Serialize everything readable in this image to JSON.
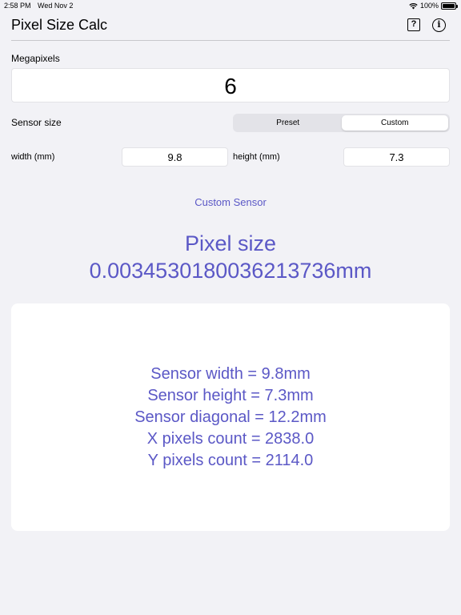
{
  "status_bar": {
    "time": "2:58 PM",
    "date": "Wed Nov 2",
    "battery": "100%"
  },
  "nav": {
    "title": "Pixel Size Calc",
    "help_icon_glyph": "?",
    "info_icon_glyph": "i"
  },
  "megapixels": {
    "label": "Megapixels",
    "value": "6"
  },
  "sensor_size": {
    "label": "Sensor size",
    "segments": [
      "Preset",
      "Custom"
    ],
    "selected": "Custom"
  },
  "dimensions": {
    "width_label": "width (mm)",
    "width_value": "9.8",
    "height_label": "height (mm)",
    "height_value": "7.3"
  },
  "custom_sensor_link": "Custom Sensor",
  "result": {
    "title": "Pixel size",
    "value": "0.003453018003621373​6mm"
  },
  "details": [
    "Sensor width = 9.8mm",
    "Sensor height = 7.3mm",
    "Sensor diagonal = 12.2mm",
    "X pixels count = 2838.0",
    "Y pixels count = 2114.0"
  ],
  "colors": {
    "accent": "#5b58c6",
    "background": "#f2f2f6"
  }
}
